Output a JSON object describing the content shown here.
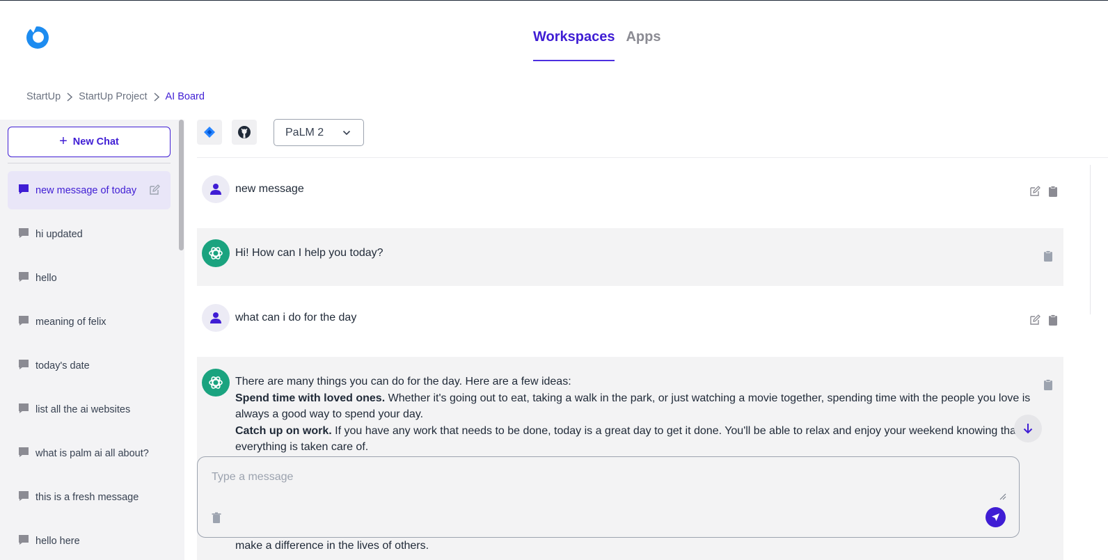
{
  "header": {
    "logo": "brand-logo",
    "tabs": [
      {
        "label": "Workspaces",
        "active": true
      },
      {
        "label": "Apps",
        "active": false
      }
    ]
  },
  "breadcrumb": [
    "StartUp",
    "StartUp Project",
    "AI Board"
  ],
  "sidebar": {
    "new_chat_label": "New Chat",
    "chats": [
      {
        "label": "new message of today",
        "active": true
      },
      {
        "label": "hi updated"
      },
      {
        "label": "hello"
      },
      {
        "label": "meaning of felix"
      },
      {
        "label": "today's date"
      },
      {
        "label": "list all the ai websites"
      },
      {
        "label": "what is palm ai all about?"
      },
      {
        "label": "this is a fresh message"
      },
      {
        "label": "hello here"
      }
    ]
  },
  "toolbar": {
    "integrations": [
      "jira-icon",
      "github-icon"
    ],
    "model": "PaLM 2"
  },
  "messages": [
    {
      "role": "user",
      "text": "new message"
    },
    {
      "role": "assistant",
      "text": "Hi! How can I help you today?"
    },
    {
      "role": "user",
      "text": "what can i do for the day"
    },
    {
      "role": "assistant",
      "intro": "There are many things you can do for the day. Here are a few ideas:",
      "items": [
        {
          "bold": "Spend time with loved ones.",
          "text": " Whether it's going out to eat, taking a walk in the park, or just watching a movie together, spending time with the people you love is always a good way to spend your day."
        },
        {
          "bold": "Catch up on work.",
          "text": " If you have any work that needs to be done, today is a great day to get it done. You'll be able to relax and enjoy your weekend knowing that everything is taken care of."
        }
      ],
      "trailing": "make a difference in the lives of others."
    }
  ],
  "composer": {
    "placeholder": "Type a message"
  },
  "colors": {
    "accent": "#3f1dd4",
    "assistant_avatar": "#1aa37f",
    "sidebar_bg": "#f3f3f5"
  }
}
